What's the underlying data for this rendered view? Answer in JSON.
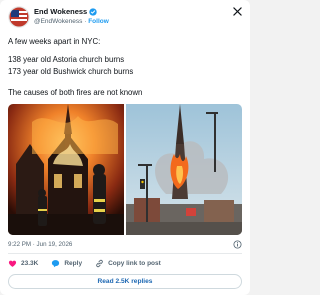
{
  "author": {
    "display_name": "End Wokeness",
    "handle": "@EndWokeness",
    "separator": "·",
    "follow_label": "Follow"
  },
  "post": {
    "lines": [
      "A few weeks apart in NYC:",
      "138 year old Astoria church burns",
      "173 year old Bushwick church burns",
      "The causes of both fires are not known"
    ],
    "timestamp": "9:22 PM · Jun 19, 2026"
  },
  "actions": {
    "like_count": "23.3K",
    "reply_label": "Reply",
    "copy_label": "Copy link to post"
  },
  "read_replies_label": "Read 2.5K replies",
  "icons": {
    "avatar": "flag-avatar",
    "verified": "verified-badge-icon",
    "platform": "x-logo-icon",
    "info": "info-icon",
    "like": "heart-icon",
    "reply": "reply-bubble-icon",
    "copy": "link-icon"
  },
  "colors": {
    "accent": "#1d9bf0",
    "like": "#f91880",
    "fire": "#f36a1c"
  }
}
